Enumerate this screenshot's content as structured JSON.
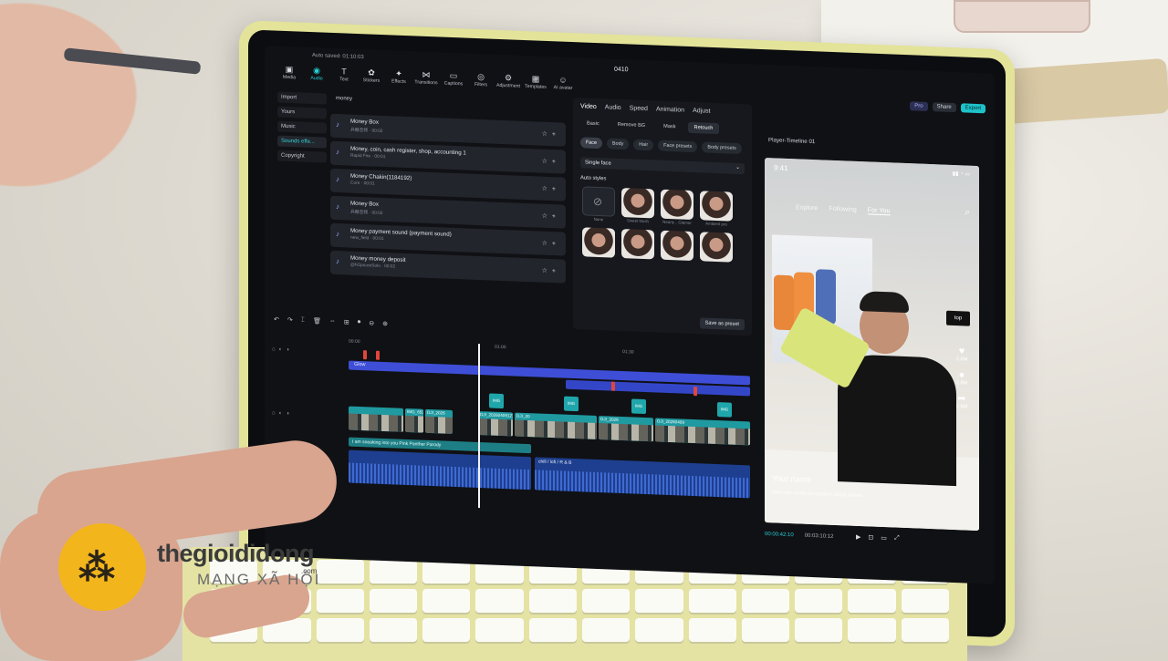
{
  "app": {
    "autosave": "Auto saved: 01:10:03",
    "project_title": "0410",
    "header_buttons": [
      "Pro",
      "Share",
      "Export"
    ]
  },
  "toolbar": [
    {
      "label": "Media",
      "glyph": "▣"
    },
    {
      "label": "Audio",
      "glyph": "◉",
      "active": true
    },
    {
      "label": "Text",
      "glyph": "T"
    },
    {
      "label": "Stickers",
      "glyph": "✿"
    },
    {
      "label": "Effects",
      "glyph": "✦"
    },
    {
      "label": "Transitions",
      "glyph": "⋈"
    },
    {
      "label": "Captions",
      "glyph": "▭"
    },
    {
      "label": "Filters",
      "glyph": "◎"
    },
    {
      "label": "Adjustment",
      "glyph": "⚙"
    },
    {
      "label": "Templates",
      "glyph": "▦"
    },
    {
      "label": "AI avatar",
      "glyph": "☺"
    }
  ],
  "categories": [
    "Import",
    "Yours",
    "Music",
    "Sounds effe...",
    "Copyright"
  ],
  "search": {
    "query": "money"
  },
  "results": [
    {
      "title": "Money Box",
      "sub": "兵器音频 · 00:02"
    },
    {
      "title": "Money, coin, cash register, shop, accounting 1",
      "sub": "Rapid Fire · 00:01"
    },
    {
      "title": "Money Chakin(1184192)",
      "sub": "Core · 00:01"
    },
    {
      "title": "Money Box",
      "sub": "兵器音频 · 00:02"
    },
    {
      "title": "Money payment sound (payment sound)",
      "sub": "new_field · 00:01"
    },
    {
      "title": "Money money deposit",
      "sub": "@hOpsoreSolo · 00:02"
    }
  ],
  "props": {
    "tabs": [
      "Video",
      "Audio",
      "Speed",
      "Animation",
      "Adjust"
    ],
    "subtabs": [
      "Basic",
      "Remove BG",
      "Mask",
      "Retouch"
    ],
    "chips": [
      "Face",
      "Body",
      "Hair",
      "Face presets",
      "Body presets"
    ],
    "select_value": "Single face",
    "autostyles_label": "Auto styles",
    "face_captions": [
      "None",
      "Sweet blush",
      "Nearly... Glamor",
      "Ambient pro"
    ],
    "save_preset": "Save as preset"
  },
  "player": {
    "title": "Player-Timeline 01",
    "status_time": "9:41",
    "nav": [
      "Explore",
      "Following",
      "For You"
    ],
    "side_counts": [
      "2.8M",
      "2.8M",
      "2.8M"
    ],
    "name": "Your name",
    "description": "Here are some description about videos",
    "logo": "top",
    "current_time": "00:00:42:10",
    "total_time": "00:03:10:12"
  },
  "timeline": {
    "ruler": [
      "00:00",
      "01:00",
      "01:30"
    ],
    "effect_label": "Glow",
    "overlay_label": "IMG",
    "clip_labels": [
      "IMG_6530",
      "DJI_2026",
      "DJI_20260409121219_0",
      "DJI_20",
      "DJI_2026",
      "DJI_20260409"
    ],
    "text_clip": "I am sneaking into you Pink Panther Parody",
    "audio_label": "chill / lofi / R & B"
  },
  "watermark": {
    "brand": "thegioididong",
    "domain": ".com",
    "tagline": "MẠNG XÃ HỘI"
  }
}
